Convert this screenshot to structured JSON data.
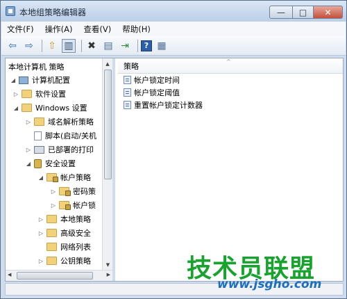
{
  "window": {
    "title": "本地组策略编辑器",
    "min": "—",
    "max": "□",
    "close": "✕"
  },
  "menu": [
    "文件(F)",
    "操作(A)",
    "查看(V)",
    "帮助(H)"
  ],
  "toolbar": {
    "back": "⇦",
    "forward": "⇨",
    "up": "⇧",
    "show": "▥",
    "delete": "✖",
    "properties": "▤",
    "export": "⇥",
    "help": "?",
    "view": "▦"
  },
  "tree": {
    "root": "本地计算机 策略",
    "computer_config": "计算机配置",
    "software_settings": "软件设置",
    "windows_settings": "Windows 设置",
    "dns_policy": "域名解析策略",
    "scripts": "脚本(启动/关机",
    "deployed_printers": "已部署的打印",
    "security_settings": "安全设置",
    "account_policies": "帐户策略",
    "password_policy": "密码策",
    "account_lockout": "帐户锁",
    "local_policies": "本地策略",
    "advanced_firewall": "高级安全",
    "network_list": "网络列表",
    "public_key": "公钥策略"
  },
  "list": {
    "header": "策略",
    "items": [
      "帐户锁定时间",
      "帐户锁定阈值",
      "重置帐户锁定计数器"
    ]
  },
  "watermark": {
    "text": "技术员联盟",
    "url": "www.jsgho.com"
  },
  "colors": {
    "frame": "#cfdced",
    "watermark_green": "#17a32e",
    "watermark_blue": "#1b6fbe"
  }
}
